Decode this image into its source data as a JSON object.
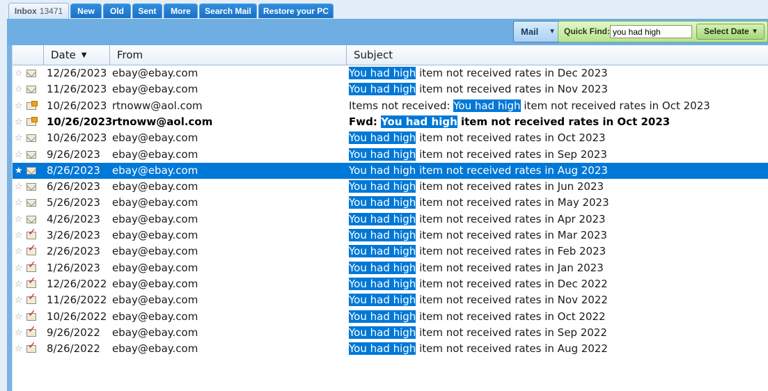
{
  "tabs": [
    {
      "label": "Inbox",
      "count": "13471",
      "active": true
    },
    {
      "label": "New"
    },
    {
      "label": "Old"
    },
    {
      "label": "Sent"
    },
    {
      "label": "More"
    },
    {
      "label": "Search Mail"
    },
    {
      "label": "Restore your PC"
    }
  ],
  "toolbar": {
    "mail_label": "Mail",
    "quick_find_label": "Quick Find:",
    "quick_find_value": "you had high",
    "select_date_label": "Select Date"
  },
  "columns": {
    "date": "Date",
    "from": "From",
    "subject": "Subject"
  },
  "highlight_term": "You had high",
  "rows": [
    {
      "date": "12/26/2023",
      "from": "ebay@ebay.com",
      "prefix": "",
      "hl": "You had high",
      "rest": " item not received rates in Dec 2023",
      "icon": "envelope-icon"
    },
    {
      "date": "11/26/2023",
      "from": "ebay@ebay.com",
      "prefix": "",
      "hl": "You had high",
      "rest": " item not received rates in Nov 2023",
      "icon": "envelope-icon"
    },
    {
      "date": "10/26/2023",
      "from": "rtnoww@aol.com",
      "prefix": "Items not received: ",
      "hl": "You had high",
      "rest": " item not received rates in Oct 2023",
      "icon": "forwarded-envelope-icon"
    },
    {
      "date": "10/26/2023",
      "from": "rtnoww@aol.com",
      "prefix": "Fwd: ",
      "hl": "You had high",
      "rest": " item not received rates in Oct 2023",
      "icon": "forwarded-envelope-icon",
      "bold": true
    },
    {
      "date": "10/26/2023",
      "from": "ebay@ebay.com",
      "prefix": "",
      "hl": "You had high",
      "rest": " item not received rates in Oct 2023",
      "icon": "envelope-icon"
    },
    {
      "date": "9/26/2023",
      "from": "ebay@ebay.com",
      "prefix": "",
      "hl": "You had high",
      "rest": " item not received rates in Sep 2023",
      "icon": "envelope-icon"
    },
    {
      "date": "8/26/2023",
      "from": "ebay@ebay.com",
      "prefix": "",
      "hl": "You had high",
      "rest": " item not received rates in Aug 2023",
      "icon": "envelope-icon",
      "selected": true
    },
    {
      "date": "6/26/2023",
      "from": "ebay@ebay.com",
      "prefix": "",
      "hl": "You had high",
      "rest": " item not received rates in Jun 2023",
      "icon": "envelope-icon"
    },
    {
      "date": "5/26/2023",
      "from": "ebay@ebay.com",
      "prefix": "",
      "hl": "You had high",
      "rest": " item not received rates in May 2023",
      "icon": "envelope-icon"
    },
    {
      "date": "4/26/2023",
      "from": "ebay@ebay.com",
      "prefix": "",
      "hl": "You had high",
      "rest": " item not received rates in Apr 2023",
      "icon": "envelope-icon"
    },
    {
      "date": "3/26/2023",
      "from": "ebay@ebay.com",
      "prefix": "",
      "hl": "You had high",
      "rest": " item not received rates in Mar 2023",
      "icon": "replied-envelope-icon"
    },
    {
      "date": "2/26/2023",
      "from": "ebay@ebay.com",
      "prefix": "",
      "hl": "You had high",
      "rest": " item not received rates in Feb 2023",
      "icon": "replied-envelope-icon"
    },
    {
      "date": "1/26/2023",
      "from": "ebay@ebay.com",
      "prefix": "",
      "hl": "You had high",
      "rest": " item not received rates in Jan 2023",
      "icon": "replied-envelope-icon"
    },
    {
      "date": "12/26/2022",
      "from": "ebay@ebay.com",
      "prefix": "",
      "hl": "You had high",
      "rest": " item not received rates in Dec 2022",
      "icon": "replied-envelope-icon"
    },
    {
      "date": "11/26/2022",
      "from": "ebay@ebay.com",
      "prefix": "",
      "hl": "You had high",
      "rest": " item not received rates in Nov 2022",
      "icon": "replied-envelope-icon"
    },
    {
      "date": "10/26/2022",
      "from": "ebay@ebay.com",
      "prefix": "",
      "hl": "You had high",
      "rest": " item not received rates in Oct 2022",
      "icon": "replied-envelope-icon"
    },
    {
      "date": "9/26/2022",
      "from": "ebay@ebay.com",
      "prefix": "",
      "hl": "You had high",
      "rest": " item not received rates in Sep 2022",
      "icon": "replied-envelope-icon"
    },
    {
      "date": "8/26/2022",
      "from": "ebay@ebay.com",
      "prefix": "",
      "hl": "You had high",
      "rest": " item not received rates in Aug 2022",
      "icon": "replied-envelope-icon"
    }
  ]
}
